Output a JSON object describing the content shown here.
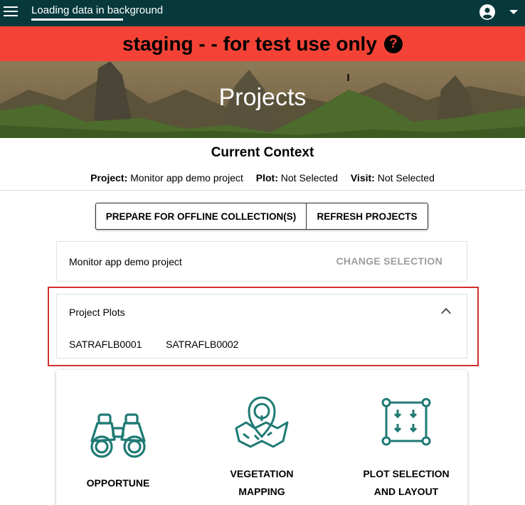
{
  "topbar": {
    "menu_icon": "hamburger-menu-icon",
    "loading_text": "Loading data in background",
    "loading_progress": 0.5,
    "account_icon": "account-circle-icon",
    "dropdown_icon": "caret-down-icon"
  },
  "banner": {
    "text": "staging - - for test use only",
    "help_icon": "help-circle-icon",
    "help_glyph": "?",
    "color": "#f44336"
  },
  "hero": {
    "title": "Projects"
  },
  "context": {
    "title": "Current Context",
    "project_label": "Project:",
    "project_value": "Monitor app demo project",
    "plot_label": "Plot:",
    "plot_value": "Not Selected",
    "visit_label": "Visit:",
    "visit_value": "Not Selected"
  },
  "actions": {
    "prepare_label": "PREPARE FOR OFFLINE COLLECTION(S)",
    "refresh_label": "REFRESH PROJECTS"
  },
  "selection": {
    "project_name": "Monitor app demo project",
    "change_label": "CHANGE SELECTION"
  },
  "plots": {
    "title": "Project Plots",
    "items": [
      "SATRAFLB0001",
      "SATRAFLB0002"
    ]
  },
  "modules": [
    {
      "label_line1": "OPPORTUNE",
      "label_line2": "",
      "icon": "binoculars-icon"
    },
    {
      "label_line1": "VEGETATION",
      "label_line2": "MAPPING",
      "icon": "map-pin-icon"
    },
    {
      "label_line1": "PLOT SELECTION",
      "label_line2": "AND LAYOUT",
      "icon": "plot-layout-icon"
    }
  ],
  "colors": {
    "topbar": "#07393c",
    "accent_teal": "#1f7a74",
    "highlight": "#d32f2f"
  }
}
